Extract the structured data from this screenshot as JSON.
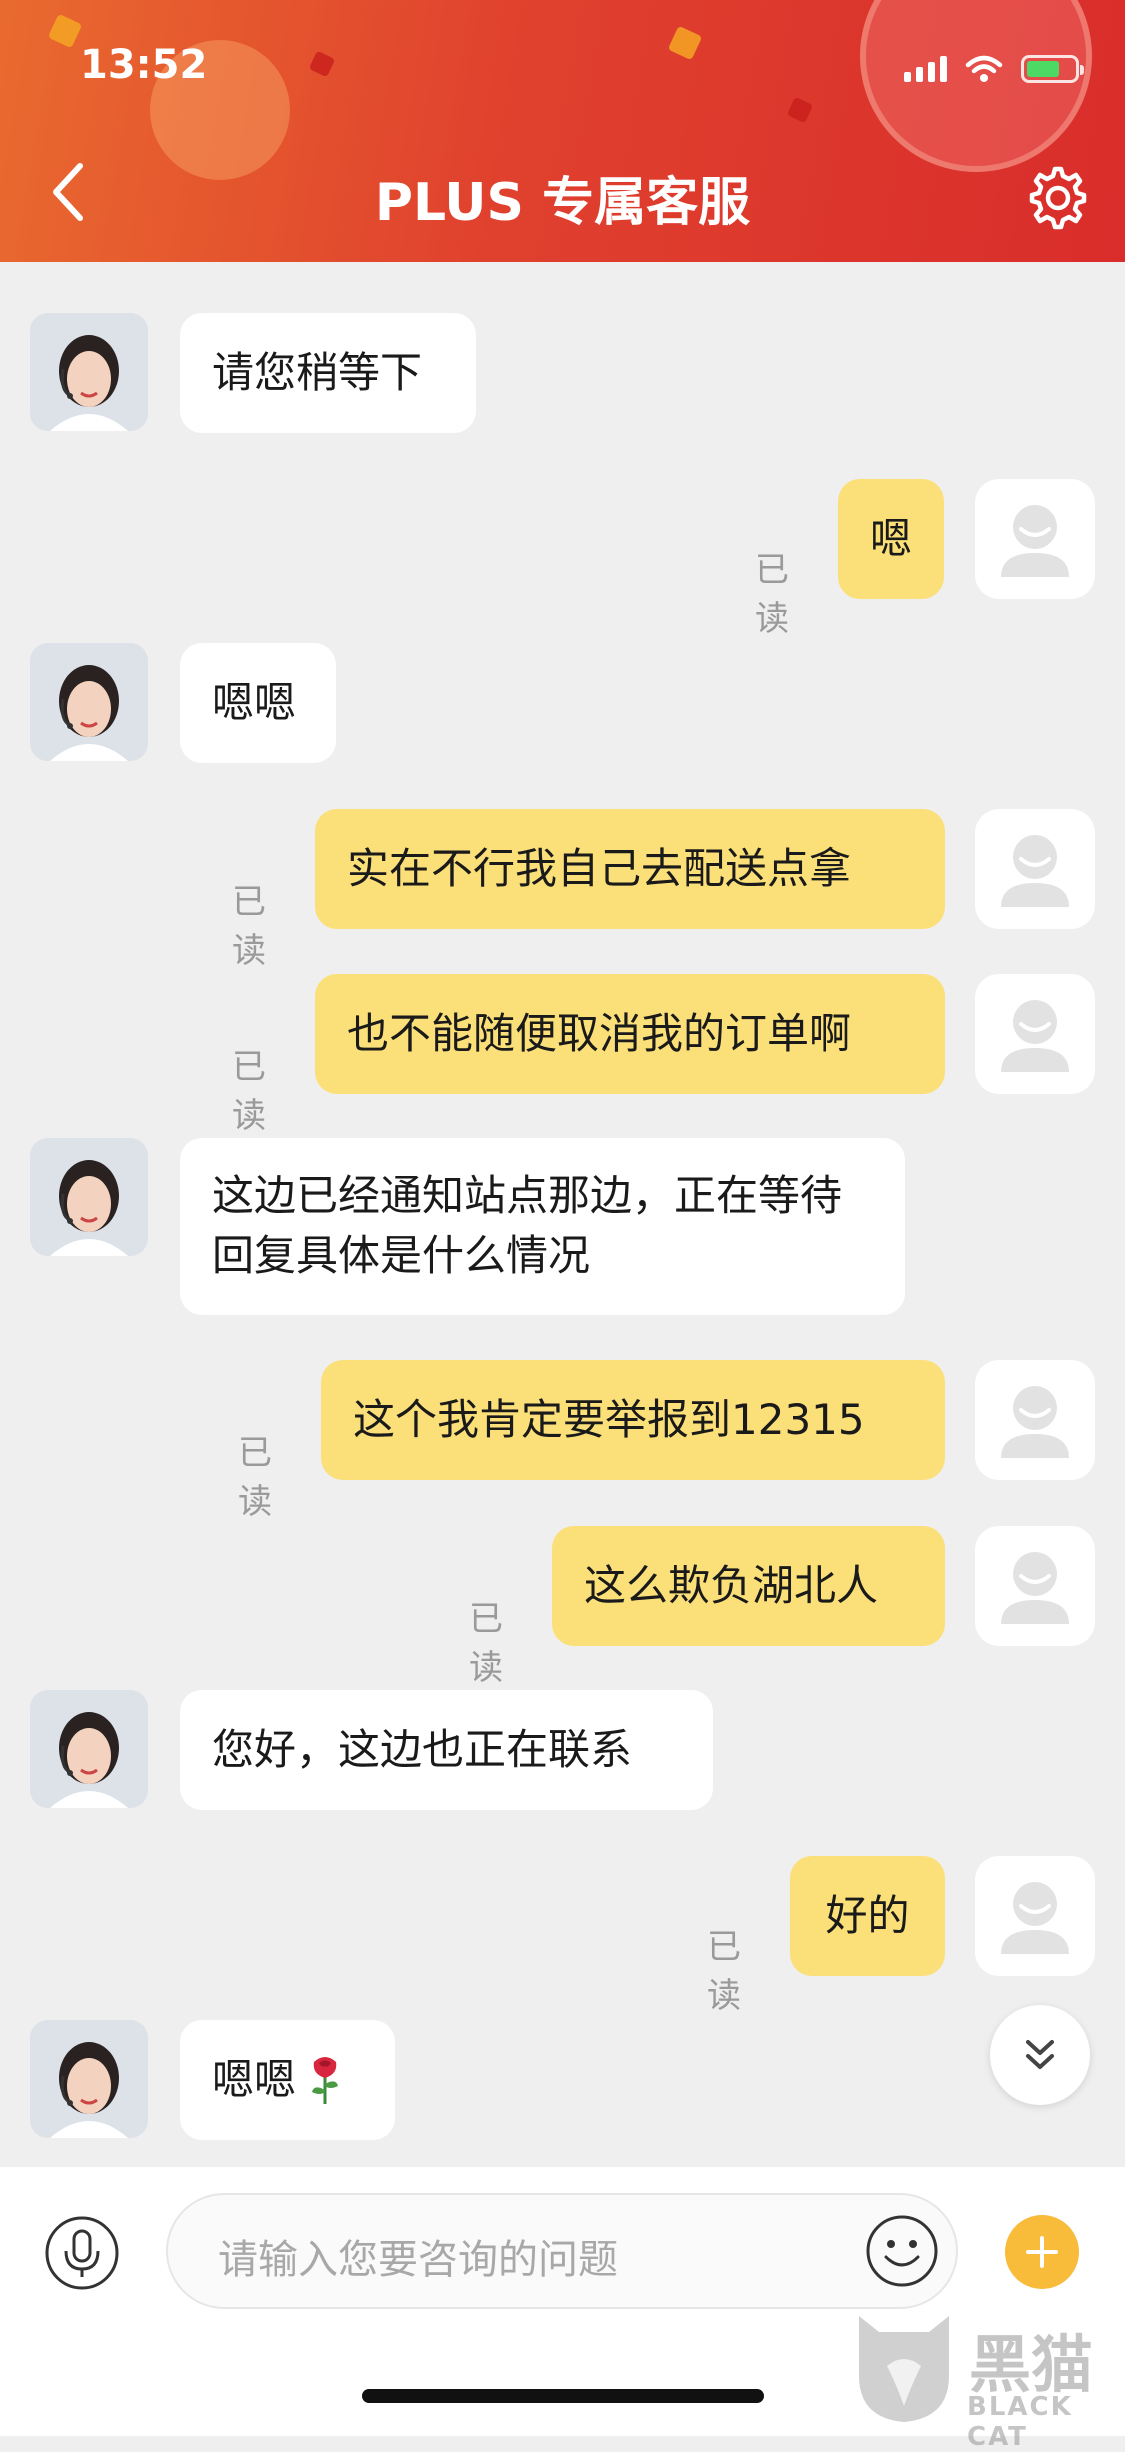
{
  "status_bar": {
    "time": "13:52"
  },
  "header": {
    "title": "PLUS 专属客服"
  },
  "read_label": "已读",
  "messages": [
    {
      "sender": "agent",
      "text": "请您稍等下"
    },
    {
      "sender": "user",
      "text": "嗯",
      "status": "已读"
    },
    {
      "sender": "agent",
      "text": "嗯嗯"
    },
    {
      "sender": "user",
      "text": "实在不行我自己去配送点拿",
      "status": "已读"
    },
    {
      "sender": "user",
      "text": "也不能随便取消我的订单啊",
      "status": "已读"
    },
    {
      "sender": "agent",
      "text": "这边已经通知站点那边，正在等待回复具体是什么情况"
    },
    {
      "sender": "user",
      "text": "这个我肯定要举报到12315",
      "status": "已读"
    },
    {
      "sender": "user",
      "text": "这么欺负湖北人",
      "status": "已读"
    },
    {
      "sender": "agent",
      "text": "您好，这边也正在联系"
    },
    {
      "sender": "user",
      "text": "好的",
      "status": "已读"
    },
    {
      "sender": "agent",
      "text": "嗯嗯",
      "emoji": "rose-icon"
    }
  ],
  "input": {
    "placeholder": "请输入您要咨询的问题"
  },
  "watermark": {
    "text": "黑猫",
    "subtext": "BLACK CAT"
  },
  "colors": {
    "header_start": "#e96a2f",
    "header_end": "#d92d2b",
    "user_bubble": "#fbe07a",
    "agent_bubble": "#ffffff",
    "plus_button": "#f8bb3a"
  },
  "icons": [
    "back-chevron-icon",
    "gear-icon",
    "signal-icon",
    "wifi-icon",
    "battery-icon",
    "microphone-icon",
    "emoji-icon",
    "plus-icon",
    "chevron-double-down-icon",
    "rose-icon",
    "default-user-avatar-icon"
  ]
}
